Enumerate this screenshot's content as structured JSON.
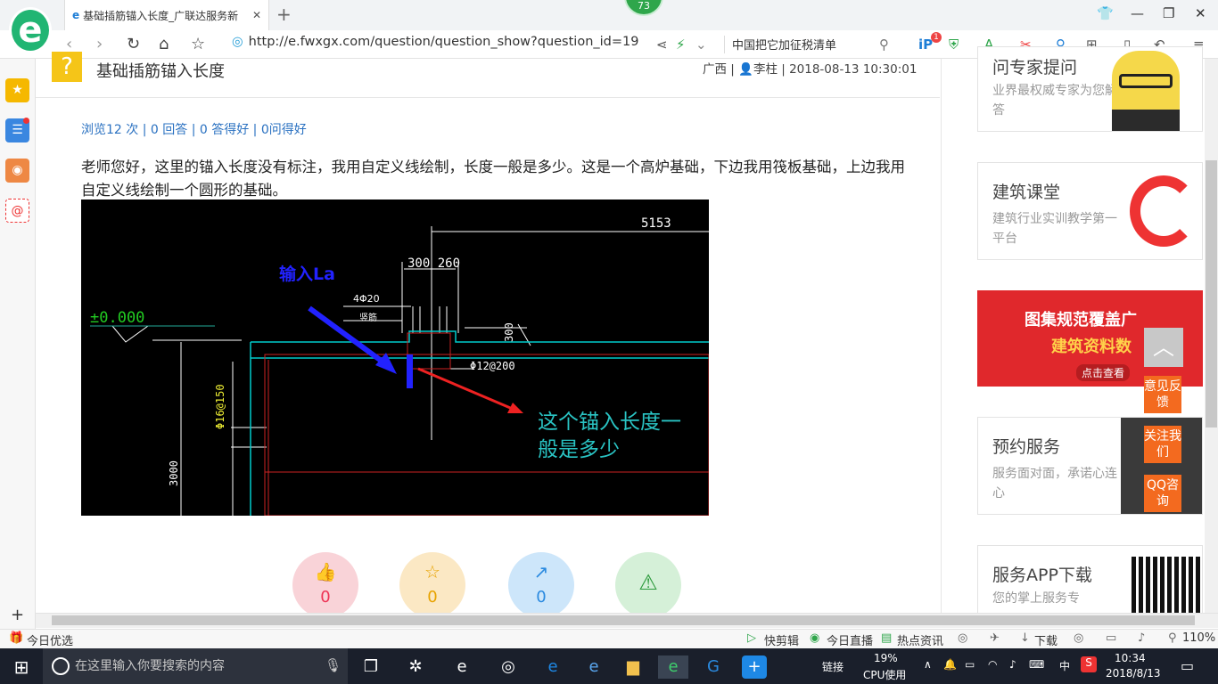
{
  "browser": {
    "tab_title": "基础插筋锚入长度_广联达服务新",
    "tab_close": "✕",
    "new_tab": "+",
    "badge": "73",
    "url_host": "http://e.fwxgx.com/question/question_show?question_id=19",
    "search_text": "中国把它加征税清单",
    "ext_badge": "1"
  },
  "question": {
    "title": "基础插筋锚入长度",
    "meta": "广西 | 👤李柱 | 2018-08-13 10:30:01",
    "stats": "浏览12 次 | 0 回答 | 0 答得好 | 0问得好",
    "body": "老师您好，这里的锚入长度没有标注，我用自定义线绘制，长度一般是多少。这是一个高炉基础，下边我用筏板基础，上边我用自定义线绘制一个圆形的基础。"
  },
  "cad": {
    "dim_5153": "5153",
    "dim_300_260": "300 260",
    "label_input_la": "输入La",
    "rebar_4phi20": "4Φ20",
    "rebar_zhujin": "竖筋",
    "elev": "±0.000",
    "rebar_phi12": "Φ12@200",
    "rebar_phi16": "Φ16@150",
    "dim_300_side": "300",
    "dim_3000": "3000",
    "question_note_1": "这个锚入长度一",
    "question_note_2": "般是多少"
  },
  "actions": [
    {
      "icon": "👍",
      "count": "0"
    },
    {
      "icon": "☆",
      "count": "0"
    },
    {
      "icon": "↗",
      "count": "0"
    },
    {
      "icon": "⚠",
      "count": ""
    }
  ],
  "right": {
    "card1_title": "问专家提问",
    "card1_sub": "业界最权威专家为您解答",
    "card2_title": "建筑课堂",
    "card2_sub": "建筑行业实训教学第一平台",
    "banner_line1": "图集规范覆盖广",
    "banner_line2": "建筑资料数",
    "banner_btn": "点击查看",
    "card3_title": "预约服务",
    "card3_sub": "服务面对面，承诺心连心",
    "card4_title": "服务APP下载",
    "card4_sub": "您的掌上服务专",
    "side_feedback": "意见反馈",
    "side_follow": "关注我们",
    "side_qq": "QQ咨询"
  },
  "statusbar": {
    "today": "今日优选",
    "kuaijianji": "快剪辑",
    "live": "今日直播",
    "news": "热点资讯",
    "download": "下载",
    "zoom": "110%"
  },
  "taskbar": {
    "search_placeholder": "在这里输入你要搜索的内容",
    "link": "链接",
    "cpu_pct": "19%",
    "cpu_label": "CPU使用",
    "ime": "中",
    "time": "10:34",
    "date": "2018/8/13"
  }
}
